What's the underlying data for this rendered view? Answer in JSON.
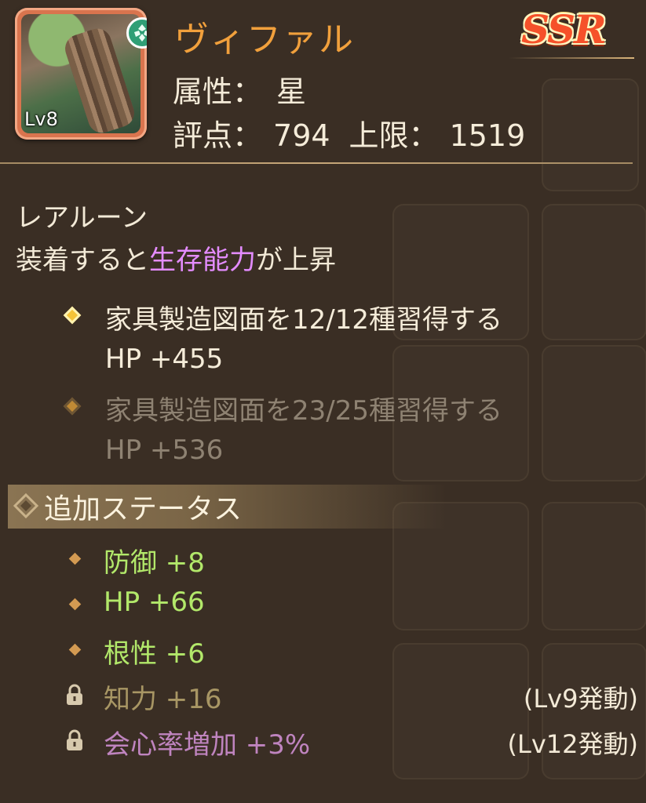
{
  "item": {
    "name": "ヴィファル",
    "level": "Lv8",
    "rarity": "SSR",
    "attribute_label": "属性：",
    "attribute_value": "星",
    "score_label": "評点：",
    "score_value": "794",
    "limit_label": "上限：",
    "limit_value": "1519"
  },
  "description": {
    "type": "レアルーン",
    "effect_prefix": "装着すると",
    "effect_highlight": "生存能力",
    "effect_suffix": "が上昇"
  },
  "conditions": [
    {
      "title": "家具製造図面を12/12種習得する",
      "value": "HP +455",
      "achieved": true
    },
    {
      "title": "家具製造図面を23/25種習得する",
      "value": "HP +536",
      "achieved": false
    }
  ],
  "extra_stats": {
    "title": "追加ステータス",
    "active": [
      {
        "label": "防御 +8"
      },
      {
        "label": "HP +66"
      },
      {
        "label": "根性 +6"
      }
    ],
    "locked": [
      {
        "label": "知力 +16",
        "unlock": "(Lv9発動)"
      },
      {
        "label": "会心率増加 +3%",
        "unlock": "(Lv12発動)"
      }
    ]
  },
  "colors": {
    "name": "#f1a03c",
    "highlight": "#e48cff",
    "active_stat": "#b2e86a",
    "rarity": "#f6512a"
  }
}
